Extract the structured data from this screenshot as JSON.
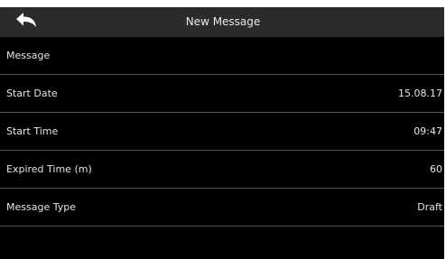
{
  "header": {
    "title": "New Message",
    "back_icon": "back-arrow-icon"
  },
  "rows": [
    {
      "label": "Message",
      "value": ""
    },
    {
      "label": "Start Date",
      "value": "15.08.17"
    },
    {
      "label": "Start Time",
      "value": "09:47"
    },
    {
      "label": "Expired Time (m)",
      "value": "60"
    },
    {
      "label": "Message Type",
      "value": "Draft"
    }
  ]
}
